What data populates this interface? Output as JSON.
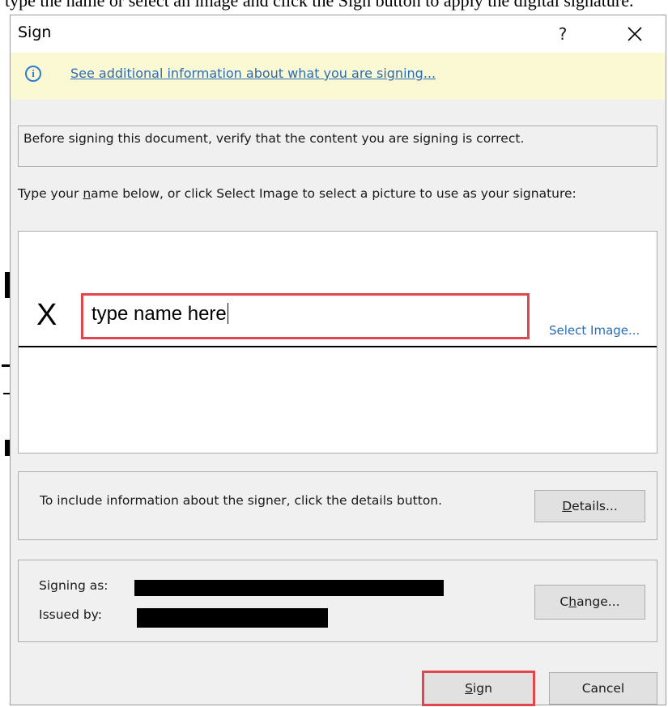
{
  "background": {
    "partial_text": "type the name or select an image and click the Sign button to apply the digital signature."
  },
  "dialog": {
    "title": "Sign",
    "help_label": "?",
    "close_icon": "close-icon"
  },
  "infobar": {
    "icon": "info-icon",
    "icon_glyph": "i",
    "link_text": "See additional information about what you are signing..."
  },
  "verify": {
    "text": "Before signing this document, verify that the content you are signing is correct."
  },
  "instruction": {
    "before": "Type your ",
    "underlined": "n",
    "after": "ame below, or click Select Image to select a picture to use as your signature:"
  },
  "signature": {
    "x_mark": "X",
    "input_value": "type name here",
    "select_image_label": "Select Image..."
  },
  "details": {
    "text": "To include information about the signer, click the details button.",
    "button_underlined": "D",
    "button_rest": "etails..."
  },
  "signer": {
    "signing_as_label": "Signing as:",
    "issued_by_label": "Issued by:",
    "change_before": "C",
    "change_underlined": "h",
    "change_rest": "ange..."
  },
  "footer": {
    "sign_underlined": "S",
    "sign_rest": "ign",
    "cancel_label": "Cancel"
  },
  "colors": {
    "highlight": "#e0474c",
    "link": "#2a6cb5",
    "infobar_bg": "#fbf8d4",
    "dialog_bg": "#f0f0f0"
  }
}
